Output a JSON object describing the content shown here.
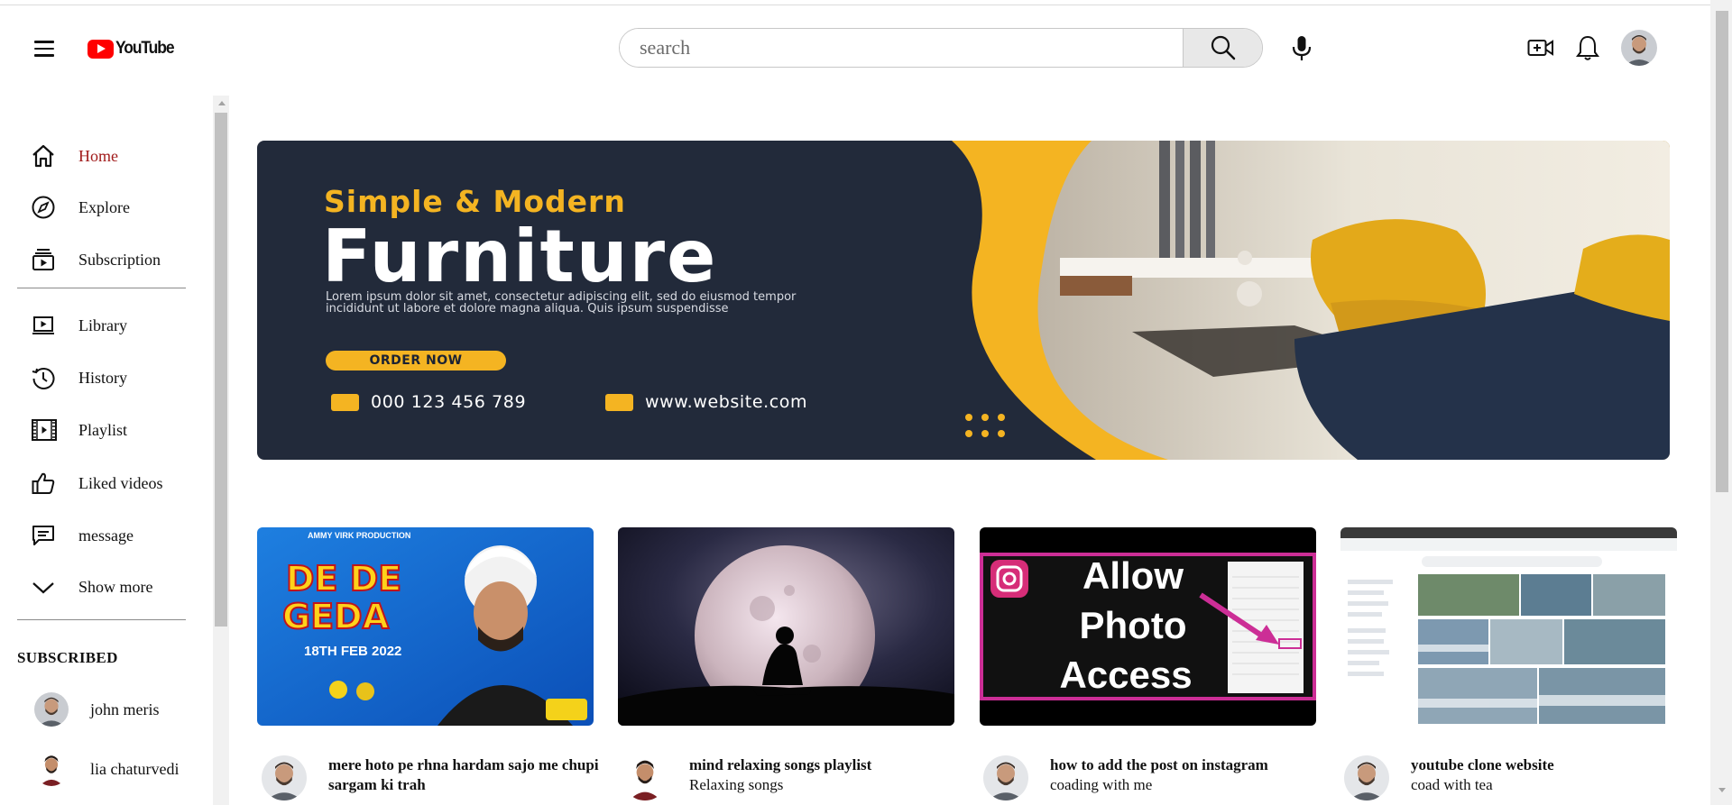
{
  "header": {
    "logo_text": "YouTube",
    "search_placeholder": "search"
  },
  "sidebar": {
    "items": [
      {
        "label": "Home",
        "icon": "home-icon"
      },
      {
        "label": "Explore",
        "icon": "compass-icon"
      },
      {
        "label": "Subscription",
        "icon": "subscriptions-icon"
      },
      {
        "label": "Library",
        "icon": "library-icon"
      },
      {
        "label": "History",
        "icon": "history-icon"
      },
      {
        "label": "Playlist",
        "icon": "playlist-icon"
      },
      {
        "label": "Liked videos",
        "icon": "thumbs-up-icon"
      },
      {
        "label": "message",
        "icon": "message-icon"
      },
      {
        "label": "Show more",
        "icon": "chevron-down-icon"
      }
    ],
    "subscribed_title": "SUBSCRIBED",
    "subscriptions": [
      {
        "name": "john meris"
      },
      {
        "name": "lia chaturvedi"
      }
    ]
  },
  "banner": {
    "tagline": "Simple & Modern",
    "headline": "Furniture",
    "body": "Lorem ipsum dolor sit amet, consectetur adipiscing elit, sed do eiusmod tempor incididunt ut labore et dolore magna aliqua. Quis ipsum suspendisse",
    "button": "ORDER NOW",
    "phone": "000 123 456 789",
    "website": "www.website.com"
  },
  "videos": [
    {
      "title": "mere hoto pe rhna hardam sajo me chupi sargam ki trah",
      "channel": "",
      "thumb_caption_top": "AMMY VIRK PRODUCTION",
      "thumb_title_1": "DE DE",
      "thumb_title_2": "GEDA",
      "thumb_date": "18TH FEB 2022"
    },
    {
      "title": "mind relaxing songs playlist",
      "channel": "Relaxing songs"
    },
    {
      "title": "how to add the post on instagram",
      "channel": "coading with me",
      "thumb_text_1": "Allow",
      "thumb_text_2": "Photo",
      "thumb_text_3": "Access"
    },
    {
      "title": "youtube clone website",
      "channel": "coad with tea"
    }
  ],
  "colors": {
    "accent_red": "#ff0000",
    "active_nav": "#a11b1b",
    "banner_bg": "#222a3a",
    "banner_yellow": "#f4b422"
  }
}
